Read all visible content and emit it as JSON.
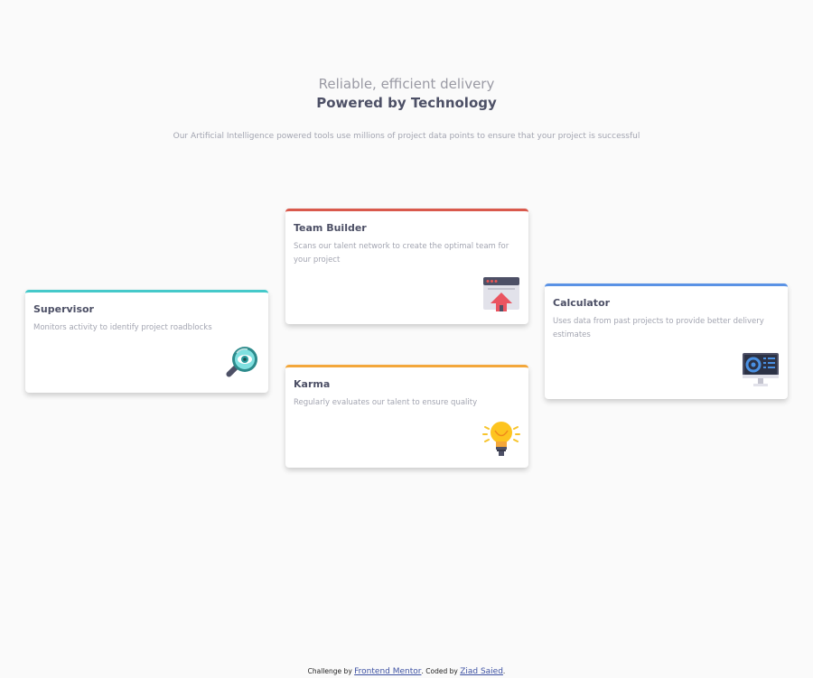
{
  "header": {
    "subtitle": "Reliable, efficient delivery",
    "title": "Powered by Technology",
    "intro": "Our Artificial Intelligence powered tools use millions of project data points to ensure that your project is successful"
  },
  "cards": {
    "supervisor": {
      "title": "Supervisor",
      "description": "Monitors activity to identify project roadblocks",
      "icon": "magnifier-eye-icon",
      "accent": "#45c9ca"
    },
    "team_builder": {
      "title": "Team Builder",
      "description": "Scans our talent network to create the optimal team for your project",
      "icon": "window-upload-icon",
      "accent": "#d9594c"
    },
    "karma": {
      "title": "Karma",
      "description": "Regularly evaluates our talent to ensure quality",
      "icon": "lightbulb-icon",
      "accent": "#f3a73b"
    },
    "calculator": {
      "title": "Calculator",
      "description": "Uses data from past projects to provide better delivery estimates",
      "icon": "monitor-dashboard-icon",
      "accent": "#5a92e5"
    }
  },
  "attribution": {
    "challenge_prefix": "Challenge by",
    "challenge_link": "Frontend Mentor",
    "coded_prefix": ". Coded by",
    "coded_link": "Ziad Saied",
    "suffix": "."
  }
}
